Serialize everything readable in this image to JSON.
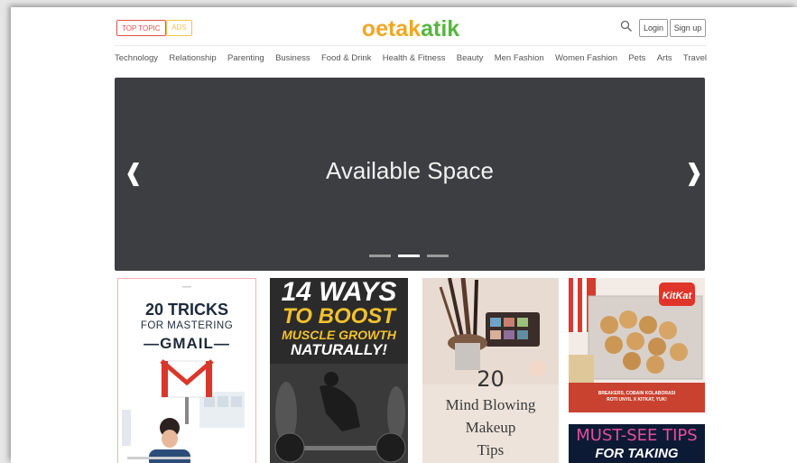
{
  "header": {
    "top_topic_label": "TOP TOPIC",
    "ads_label": "ADS",
    "logo_part1": "oetak",
    "logo_part2": "atik",
    "login_label": "Login",
    "signup_label": "Sign up"
  },
  "nav": {
    "items": [
      "Technology",
      "Relationship",
      "Parenting",
      "Business",
      "Food & Drink",
      "Health & Fitness",
      "Beauty",
      "Men Fashion",
      "Women Fashion",
      "Pets",
      "Arts",
      "Travel"
    ]
  },
  "slider": {
    "text": "Available Space",
    "prev_glyph": "❰",
    "next_glyph": "❱",
    "active_dot": 2
  },
  "cards": [
    {
      "line1": "20 TRICKS",
      "line2": "FOR MASTERING",
      "line3": "—GMAIL—"
    },
    {
      "line1": "14 WAYS",
      "line2": "TO BOOST",
      "line3": "MUSCLE GROWTH",
      "line4": "NATURALLY!"
    },
    {
      "line1": "20",
      "line2": "Mind Blowing",
      "line3": "Makeup",
      "line4": "Tips"
    },
    {
      "caption1": "BREAKERS, COBAIN KOLABORASI",
      "caption2": "ROTI UNYIL X KITKAT, YUK!",
      "brand": "KitKat"
    },
    {
      "line1": "MUST-SEE TIPS",
      "line2": "FOR TAKING"
    }
  ],
  "colors": {
    "logo_orange": "#f0a821",
    "logo_green": "#55b73c",
    "top_topic": "#e0524b",
    "ads": "#f1c24a",
    "slider_bg": "#3c3e41"
  }
}
